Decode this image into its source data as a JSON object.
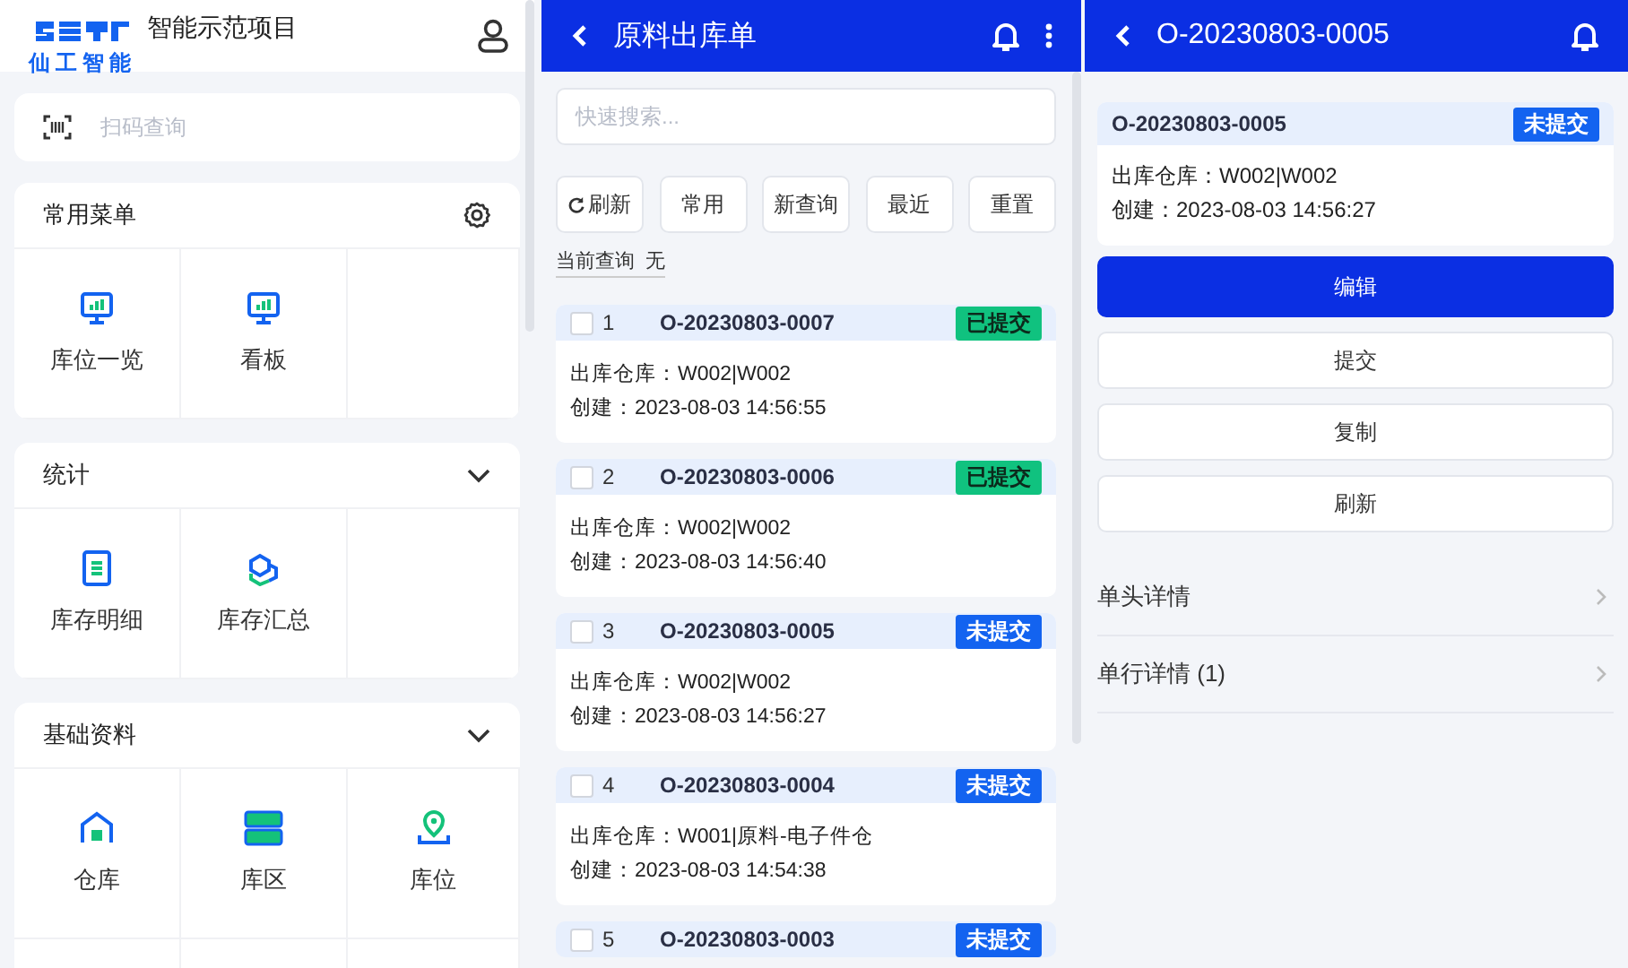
{
  "menu_panel": {
    "logo_text": "仙工智能",
    "title": "智能示范项目",
    "scan": {
      "placeholder": "扫码查询"
    },
    "sections": [
      {
        "title": "常用菜单",
        "kind": "settings",
        "items": [
          {
            "label": "库位一览",
            "kind": "monitor"
          },
          {
            "label": "看板",
            "kind": "monitor"
          }
        ]
      },
      {
        "title": "统计",
        "kind": "collapse",
        "items": [
          {
            "label": "库存明细",
            "kind": "document"
          },
          {
            "label": "库存汇总",
            "kind": "cubes"
          }
        ]
      },
      {
        "title": "基础资料",
        "kind": "collapse",
        "items": [
          {
            "label": "仓库",
            "kind": "house"
          },
          {
            "label": "库区",
            "kind": "shelves"
          },
          {
            "label": "库位",
            "kind": "pin"
          }
        ]
      }
    ]
  },
  "list_panel": {
    "title": "原料出库单",
    "search": {
      "placeholder": "快速搜索..."
    },
    "buttons": [
      {
        "label": "刷新",
        "kind": "refresh"
      },
      {
        "label": "常用",
        "kind": "plain"
      },
      {
        "label": "新查询",
        "kind": "plain"
      },
      {
        "label": "最近",
        "kind": "plain"
      },
      {
        "label": "重置",
        "kind": "plain"
      }
    ],
    "query_label": "当前查询",
    "query_value": "无",
    "orders": [
      {
        "index": "1",
        "number": "O-20230803-0007",
        "status": "已提交",
        "submitted": true,
        "checked": false,
        "lines": [
          "出库仓库：W002|W002",
          "创建：2023-08-03 14:56:55"
        ]
      },
      {
        "index": "2",
        "number": "O-20230803-0006",
        "status": "已提交",
        "submitted": true,
        "checked": false,
        "lines": [
          "出库仓库：W002|W002",
          "创建：2023-08-03 14:56:40"
        ]
      },
      {
        "index": "3",
        "number": "O-20230803-0005",
        "status": "未提交",
        "submitted": false,
        "checked": false,
        "lines": [
          "出库仓库：W002|W002",
          "创建：2023-08-03 14:56:27"
        ]
      },
      {
        "index": "4",
        "number": "O-20230803-0004",
        "status": "未提交",
        "submitted": false,
        "checked": false,
        "lines": [
          "出库仓库：W001|原料-电子件仓",
          "创建：2023-08-03 14:54:38"
        ]
      },
      {
        "index": "5",
        "number": "O-20230803-0003",
        "status": "未提交",
        "submitted": false,
        "checked": false
      }
    ]
  },
  "detail_panel": {
    "title": "O-20230803-0005",
    "number": "O-20230803-0005",
    "status": "未提交",
    "submitted": false,
    "lines": [
      "出库仓库：W002|W002",
      "创建：2023-08-03 14:56:27"
    ],
    "actions": [
      {
        "label": "编辑",
        "primary": true
      },
      {
        "label": "提交",
        "primary": false
      },
      {
        "label": "复制",
        "primary": false
      },
      {
        "label": "刷新",
        "primary": false
      }
    ],
    "links": [
      "单头详情",
      "单行详情 (1)"
    ]
  }
}
